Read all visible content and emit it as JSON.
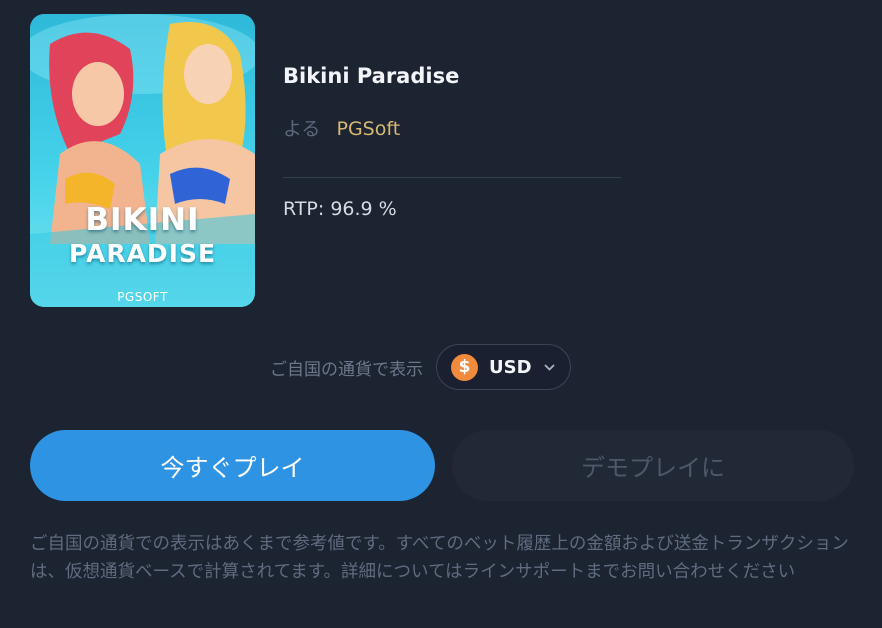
{
  "game": {
    "title": "Bikini Paradise",
    "by_label": "よる",
    "provider": "PGSoft",
    "rtp": "RTP: 96.9 %"
  },
  "thumbnail": {
    "title_line1": "BIKINI",
    "title_line2": "PARADISE",
    "brand": "PGSOFT"
  },
  "currency": {
    "label": "ご自国の通貨で表示",
    "coin_symbol": "$",
    "code": "USD",
    "coin_color": "#f08a3c"
  },
  "buttons": {
    "play": "今すぐプレイ",
    "demo": "デモプレイに"
  },
  "disclaimer": "ご自国の通貨での表示はあくまで参考値です。すべてのベット履歴上の金額および送金トランザクションは、仮想通貨ベースで計算されてます。詳細についてはラインサポートまでお問い合わせください",
  "colors": {
    "background": "#1c2331",
    "accent": "#2f93e3",
    "provider": "#d7b873"
  }
}
